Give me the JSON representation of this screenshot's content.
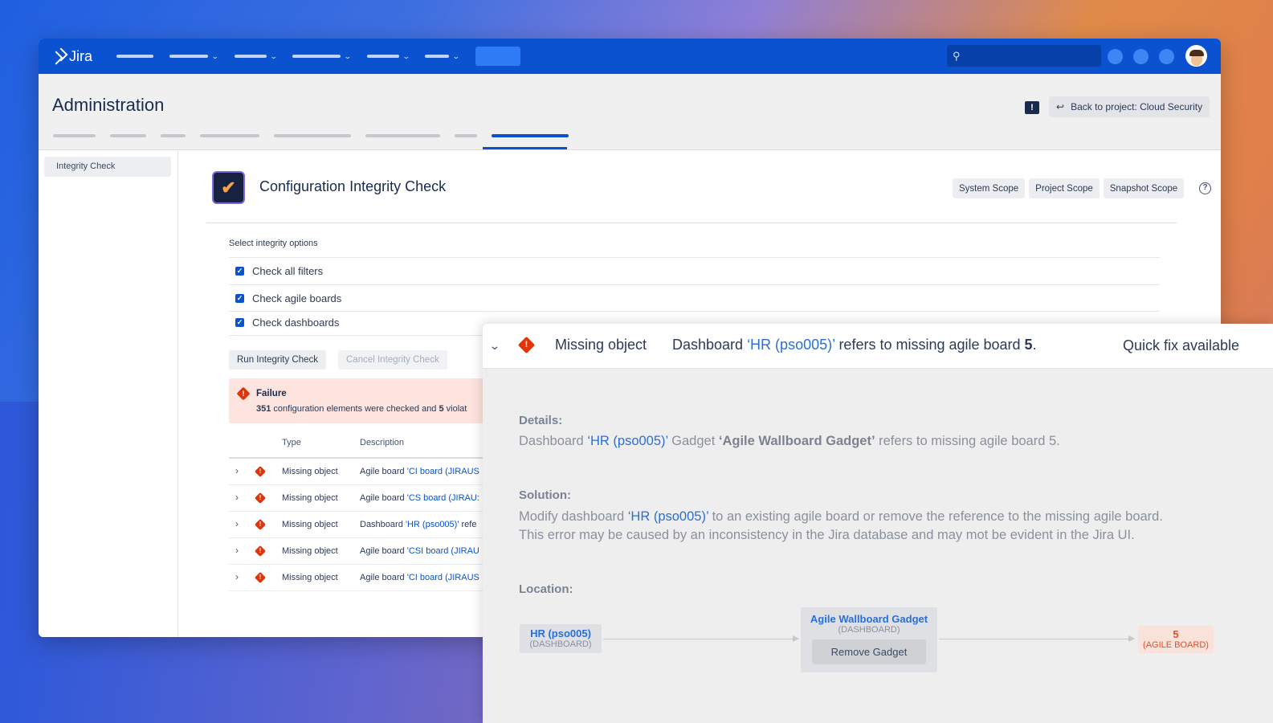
{
  "app": {
    "name": "Jira"
  },
  "header": {
    "title": "Administration",
    "back_button": "Back to project: Cloud Security"
  },
  "sidebar": {
    "items": [
      {
        "label": "Integrity Check"
      }
    ]
  },
  "main": {
    "title": "Configuration Integrity Check",
    "scope_buttons": [
      "System Scope",
      "Project Scope",
      "Snapshot Scope"
    ],
    "options_label": "Select integrity options",
    "options": [
      {
        "label": "Check all filters",
        "checked": true
      },
      {
        "label": "Check agile boards",
        "checked": true
      },
      {
        "label": "Check dashboards",
        "checked": true
      }
    ],
    "run_button": "Run Integrity Check",
    "cancel_button": "Cancel Integrity Check"
  },
  "failure": {
    "title": "Failure",
    "checked_count": "351",
    "text_mid": " configuration elements were checked and ",
    "violations_count": "5",
    "text_end": " violat"
  },
  "table": {
    "headers": {
      "type": "Type",
      "description": "Description"
    },
    "rows": [
      {
        "type": "Missing object",
        "desc_prefix": "Agile board ",
        "desc_link": "'CI board (JIRAUS"
      },
      {
        "type": "Missing object",
        "desc_prefix": "Agile board ",
        "desc_link": "'CS board (JIRAU:"
      },
      {
        "type": "Missing object",
        "desc_prefix": "Dashboard ",
        "desc_link": "'HR (pso005)'",
        "desc_suffix": " refe"
      },
      {
        "type": "Missing object",
        "desc_prefix": "Agile board ",
        "desc_link": "'CSI board (JIRAU"
      },
      {
        "type": "Missing object",
        "desc_prefix": "Agile board ",
        "desc_link": "'CI board (JIRAUS"
      }
    ]
  },
  "panel": {
    "type": "Missing object",
    "desc_prefix": "Dashboard ",
    "desc_link": "‘HR (pso005)’",
    "desc_mid": " refers to missing agile board ",
    "desc_number": "5",
    "desc_end": ".",
    "quick_fix": "Quick fix available",
    "details_label": "Details:",
    "details": {
      "prefix": "Dashboard ",
      "link": "‘HR (pso005)’",
      "mid": " Gadget ",
      "bold": "‘Agile Wallboard Gadget’",
      "end": "  refers to missing agile board 5."
    },
    "solution_label": "Solution:",
    "solution": {
      "line1_prefix": "Modify dashboard ",
      "line1_link": "‘HR (pso005)’",
      "line1_end": " to an existing agile board or remove the reference to the missing agile board.",
      "line2": "This error may be caused by an inconsistency in the Jira database and may mot be evident in the Jira UI."
    },
    "location_label": "Location:",
    "location": {
      "source": {
        "name": "HR (pso005)",
        "type": "(DASHBOARD)"
      },
      "gadget": {
        "name": "Agile Wallboard Gadget",
        "type": "(DASHBOARD)",
        "action": "Remove Gadget"
      },
      "target": {
        "name": "5",
        "type": "(AGILE BOARD)"
      }
    }
  },
  "colors": {
    "nav": "#0a52cf",
    "error": "#de350b",
    "link": "#0a52cf"
  },
  "icons": [
    "jira-logo",
    "search-icon",
    "feedback-icon",
    "back-arrow-icon",
    "check-icon",
    "help-icon",
    "error-icon",
    "chevron-right-icon",
    "chevron-down-icon"
  ]
}
